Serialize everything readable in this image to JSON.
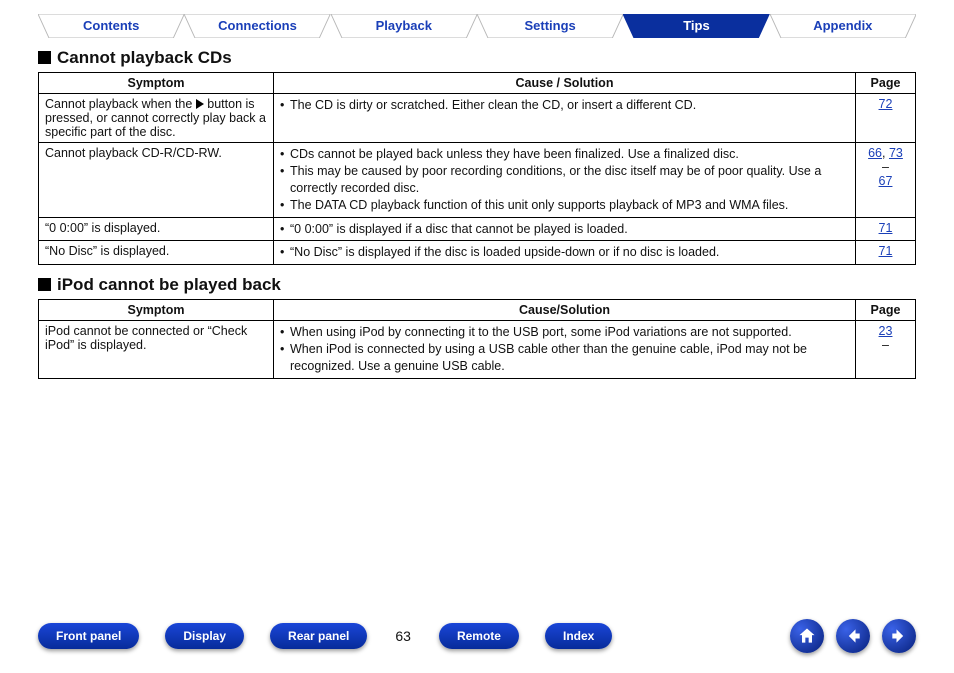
{
  "tabs": [
    {
      "label": "Contents",
      "active": false
    },
    {
      "label": "Connections",
      "active": false
    },
    {
      "label": "Playback",
      "active": false
    },
    {
      "label": "Settings",
      "active": false
    },
    {
      "label": "Tips",
      "active": true
    },
    {
      "label": "Appendix",
      "active": false
    }
  ],
  "sections": [
    {
      "title": "Cannot playback CDs",
      "headers": {
        "symptom": "Symptom",
        "cause": "Cause / Solution",
        "page": "Page"
      },
      "rows": [
        {
          "symptom_pre": "Cannot playback when the ",
          "symptom_has_play_icon": true,
          "symptom_post": " button is pressed, or cannot correctly play back a specific part of the disc.",
          "causes": [
            "The CD is dirty or scratched. Either clean the CD, or insert a different CD."
          ],
          "pages": [
            [
              "72"
            ]
          ]
        },
        {
          "symptom_pre": "Cannot playback CD-R/CD-RW.",
          "symptom_has_play_icon": false,
          "symptom_post": "",
          "causes": [
            "CDs cannot be played back unless they have been finalized. Use a finalized disc.",
            "This may be caused by poor recording conditions, or the disc itself may be of poor quality. Use a correctly recorded disc.",
            "The DATA CD playback function of this unit only supports playback of MP3 and WMA files."
          ],
          "pages": [
            [
              "66",
              "73"
            ],
            [
              "–"
            ],
            [
              "67"
            ]
          ]
        },
        {
          "symptom_pre": "“0 0:00” is displayed.",
          "symptom_has_play_icon": false,
          "symptom_post": "",
          "causes": [
            "“0 0:00” is displayed if a disc that cannot be played is loaded."
          ],
          "pages": [
            [
              "71"
            ]
          ]
        },
        {
          "symptom_pre": "“No Disc” is displayed.",
          "symptom_has_play_icon": false,
          "symptom_post": "",
          "causes": [
            "“No Disc” is displayed if the disc is loaded upside-down or if no disc is loaded."
          ],
          "pages": [
            [
              "71"
            ]
          ]
        }
      ]
    },
    {
      "title": "iPod cannot be played back",
      "headers": {
        "symptom": "Symptom",
        "cause": "Cause/Solution",
        "page": "Page"
      },
      "rows": [
        {
          "symptom_pre": "iPod cannot be connected or “Check iPod” is displayed.",
          "symptom_has_play_icon": false,
          "symptom_post": "",
          "causes": [
            "When using iPod by connecting it to the USB port, some iPod variations are not supported.",
            "When iPod is connected by using a USB cable other than the genuine cable, iPod may not be recognized. Use a genuine USB cable."
          ],
          "pages": [
            [
              "23"
            ],
            [
              "–"
            ]
          ]
        }
      ]
    }
  ],
  "footer": {
    "left_pills": [
      "Front panel",
      "Display",
      "Rear panel"
    ],
    "page_number": "63",
    "right_pills": [
      "Remote",
      "Index"
    ],
    "icons": [
      "home",
      "prev",
      "next"
    ]
  }
}
